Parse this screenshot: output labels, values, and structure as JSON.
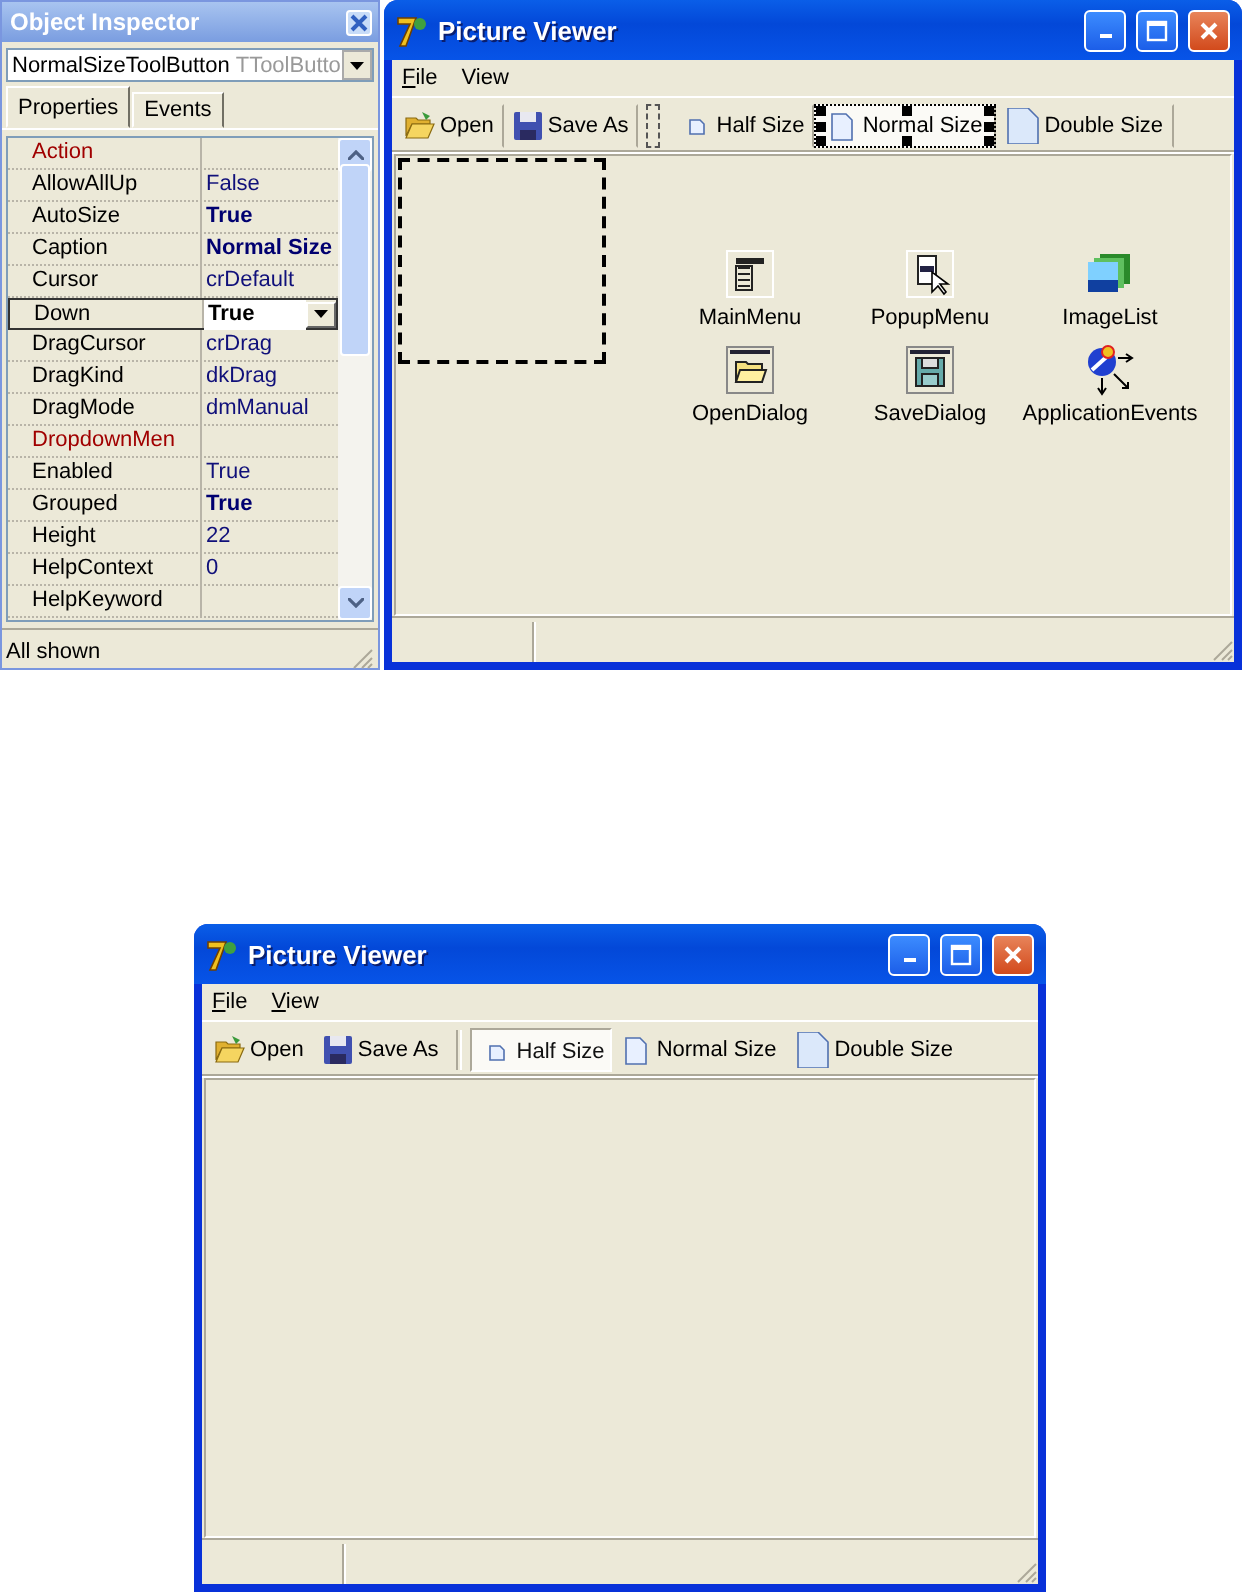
{
  "object_inspector": {
    "title": "Object Inspector",
    "object": {
      "name": "NormalSizeToolButton",
      "class": "TToolButto"
    },
    "tabs": [
      {
        "label": "Properties",
        "selected": true
      },
      {
        "label": "Events",
        "selected": false
      }
    ],
    "properties": [
      {
        "name": "Action",
        "kind": "reference",
        "selected": false
      },
      {
        "name": "AllowAllUp",
        "value": "False",
        "kind": "plain",
        "modified": false,
        "selected": false
      },
      {
        "name": "AutoSize",
        "value": "True",
        "kind": "plain",
        "modified": true,
        "selected": false
      },
      {
        "name": "Caption",
        "value": "Normal Size",
        "kind": "plain",
        "modified": true,
        "selected": false
      },
      {
        "name": "Cursor",
        "value": "crDefault",
        "kind": "plain",
        "modified": false,
        "selected": false
      },
      {
        "name": "Down",
        "value": "True",
        "kind": "plain",
        "modified": true,
        "selected": true
      },
      {
        "name": "DragCursor",
        "value": "crDrag",
        "kind": "plain",
        "modified": false,
        "selected": false
      },
      {
        "name": "DragKind",
        "value": "dkDrag",
        "kind": "plain",
        "modified": false,
        "selected": false
      },
      {
        "name": "DragMode",
        "value": "dmManual",
        "kind": "plain",
        "modified": false,
        "selected": false
      },
      {
        "name": "DropdownMen",
        "kind": "reference",
        "selected": false
      },
      {
        "name": "Enabled",
        "value": "True",
        "kind": "plain",
        "modified": false,
        "selected": false
      },
      {
        "name": "Grouped",
        "value": "True",
        "kind": "plain",
        "modified": true,
        "selected": false
      },
      {
        "name": "Height",
        "value": "22",
        "kind": "plain",
        "modified": false,
        "selected": false
      },
      {
        "name": "HelpContext",
        "value": "0",
        "kind": "plain",
        "modified": false,
        "selected": false
      },
      {
        "name": "HelpKeyword",
        "kind": "plain",
        "selected": false
      }
    ],
    "status": "All shown"
  },
  "designer_window": {
    "title": "Picture Viewer",
    "menu": [
      {
        "label": "File",
        "mnemonic": true
      },
      {
        "label": "View",
        "mnemonic": false
      }
    ],
    "toolbar": [
      {
        "kind": "button",
        "label": "Open",
        "selected": false
      },
      {
        "kind": "button",
        "label": "Save As",
        "selected": false
      },
      {
        "kind": "separator"
      },
      {
        "kind": "button",
        "label": "Half Size",
        "selected": false
      },
      {
        "kind": "button",
        "label": "Normal Size",
        "selected": true
      },
      {
        "kind": "button",
        "label": "Double Size",
        "selected": false
      }
    ],
    "components": [
      {
        "kind": "image"
      },
      {
        "kind": "component",
        "label": "MainMenu"
      },
      {
        "kind": "component",
        "label": "PopupMenu"
      },
      {
        "kind": "component",
        "label": "ImageList"
      },
      {
        "kind": "component",
        "label": "OpenDialog"
      },
      {
        "kind": "component",
        "label": "SaveDialog"
      },
      {
        "kind": "component",
        "label": "ApplicationEvents"
      }
    ]
  },
  "app_window": {
    "title": "Picture Viewer",
    "menu": [
      {
        "label": "File",
        "mnemonic": true
      },
      {
        "label": "View",
        "mnemonic": true
      }
    ],
    "toolbar": [
      {
        "kind": "button",
        "label": "Open",
        "down": false
      },
      {
        "kind": "button",
        "label": "Save As",
        "down": false
      },
      {
        "kind": "separator"
      },
      {
        "kind": "button",
        "label": "Half Size",
        "down": true
      },
      {
        "kind": "button",
        "label": "Normal Size",
        "down": false
      },
      {
        "kind": "button",
        "label": "Double Size",
        "down": false
      }
    ]
  }
}
